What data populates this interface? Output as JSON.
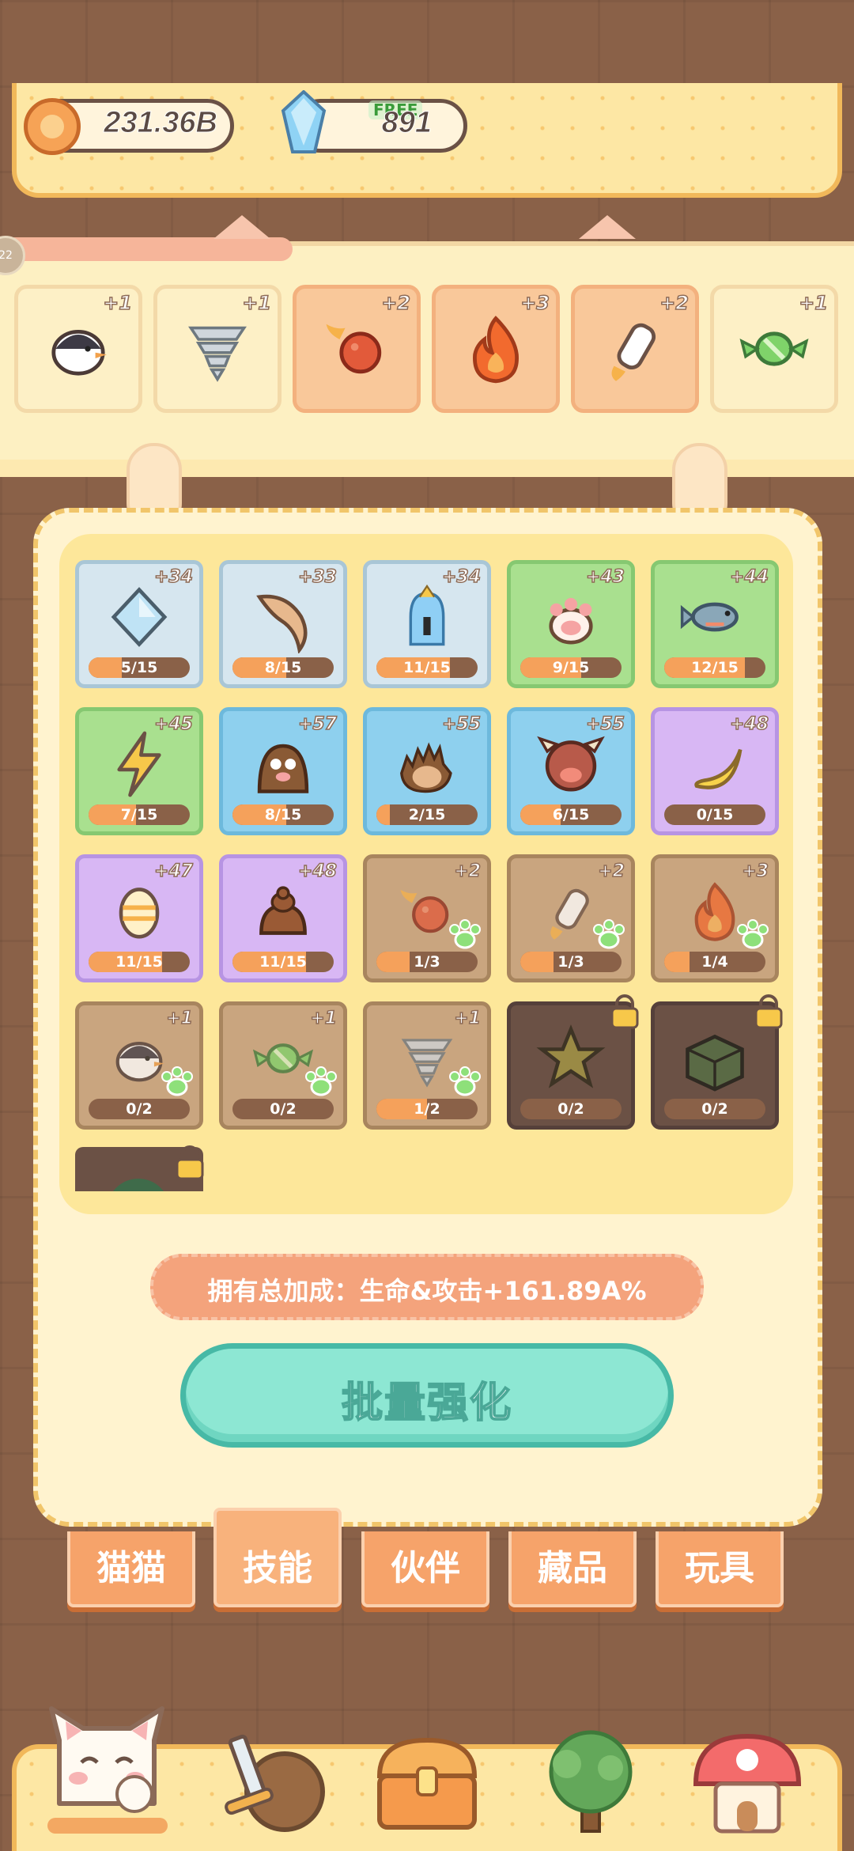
{
  "currency": {
    "coins": "231.36B",
    "gems": "891",
    "free_label": "FREE",
    "coin_icon": "cat-coin-icon",
    "gem_icon": "blue-crystal-icon"
  },
  "side_button_label": "22",
  "equipped": [
    {
      "name": "penguin",
      "plus": "+1",
      "highlight": false
    },
    {
      "name": "tornado",
      "plus": "+1",
      "highlight": false
    },
    {
      "name": "fireball",
      "plus": "+2",
      "highlight": true
    },
    {
      "name": "flame",
      "plus": "+3",
      "highlight": true
    },
    {
      "name": "rocket",
      "plus": "+2",
      "highlight": true
    },
    {
      "name": "candy",
      "plus": "+1",
      "highlight": false
    }
  ],
  "skills": [
    {
      "name": "diamond",
      "plus": "+34",
      "progress": "5/15",
      "ratio": 0.33,
      "category": "blue"
    },
    {
      "name": "boomerang",
      "plus": "+33",
      "progress": "8/15",
      "ratio": 0.53,
      "category": "blue"
    },
    {
      "name": "ghost-cat",
      "plus": "+34",
      "progress": "11/15",
      "ratio": 0.73,
      "category": "blue"
    },
    {
      "name": "paw",
      "plus": "+43",
      "progress": "9/15",
      "ratio": 0.6,
      "category": "green"
    },
    {
      "name": "fish",
      "plus": "+44",
      "progress": "12/15",
      "ratio": 0.8,
      "category": "green"
    },
    {
      "name": "lightning",
      "plus": "+45",
      "progress": "7/15",
      "ratio": 0.47,
      "category": "green"
    },
    {
      "name": "mole",
      "plus": "+57",
      "progress": "8/15",
      "ratio": 0.53,
      "category": "sky"
    },
    {
      "name": "hedgehog",
      "plus": "+55",
      "progress": "2/15",
      "ratio": 0.13,
      "category": "sky"
    },
    {
      "name": "boar",
      "plus": "+55",
      "progress": "6/15",
      "ratio": 0.4,
      "category": "sky"
    },
    {
      "name": "banana",
      "plus": "+48",
      "progress": "0/15",
      "ratio": 0.0,
      "category": "purple"
    },
    {
      "name": "egg",
      "plus": "+47",
      "progress": "11/15",
      "ratio": 0.73,
      "category": "purple"
    },
    {
      "name": "poop-bag",
      "plus": "+48",
      "progress": "11/15",
      "ratio": 0.73,
      "category": "purple"
    },
    {
      "name": "fireball",
      "plus": "+2",
      "progress": "1/3",
      "ratio": 0.33,
      "category": "brown"
    },
    {
      "name": "rocket",
      "plus": "+2",
      "progress": "1/3",
      "ratio": 0.33,
      "category": "brown"
    },
    {
      "name": "flame",
      "plus": "+3",
      "progress": "1/4",
      "ratio": 0.25,
      "category": "brown"
    },
    {
      "name": "penguin",
      "plus": "+1",
      "progress": "0/2",
      "ratio": 0.0,
      "category": "brown"
    },
    {
      "name": "candy",
      "plus": "+1",
      "progress": "0/2",
      "ratio": 0.0,
      "category": "brown"
    },
    {
      "name": "tornado",
      "plus": "+1",
      "progress": "1/2",
      "ratio": 0.5,
      "category": "brown"
    },
    {
      "name": "star",
      "plus": "",
      "progress": "0/2",
      "ratio": 0.0,
      "category": "dark",
      "locked": true
    },
    {
      "name": "box",
      "plus": "",
      "progress": "0/2",
      "ratio": 0.0,
      "category": "dark",
      "locked": true
    }
  ],
  "bonus_text": "拥有总加成：生命&攻击+161.89A%",
  "batch_button": "批量强化",
  "tabs": [
    {
      "label": "猫猫",
      "active": false
    },
    {
      "label": "技能",
      "active": true
    },
    {
      "label": "伙伴",
      "active": false
    },
    {
      "label": "藏品",
      "active": false
    },
    {
      "label": "玩具",
      "active": false
    }
  ],
  "nav": [
    {
      "name": "cat-home-icon"
    },
    {
      "name": "sword-shield-icon"
    },
    {
      "name": "treasure-chest-icon"
    },
    {
      "name": "tree-icon"
    },
    {
      "name": "mushroom-house-icon"
    }
  ]
}
